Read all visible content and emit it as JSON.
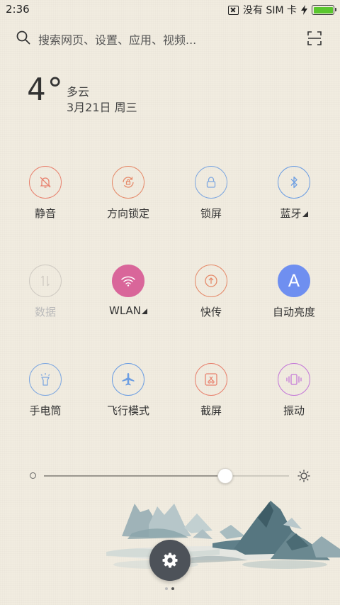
{
  "status_bar": {
    "time": "2:36",
    "carrier": "没有 SIM 卡",
    "icons": [
      "no-sim-icon",
      "charging-bolt-icon",
      "battery-icon"
    ],
    "battery_level_pct": 100,
    "battery_color": "#5ac62e"
  },
  "search": {
    "placeholder": "搜索网页、设置、应用、视频...",
    "icons": [
      "search-icon",
      "scan-icon"
    ]
  },
  "weather": {
    "temperature": "4°",
    "condition": "多云",
    "date": "3月21日 周三"
  },
  "toggles": [
    {
      "label": "静音",
      "icon": "bell-off-icon",
      "color": "#e8826f",
      "active": false,
      "has_arrow": false
    },
    {
      "label": "方向锁定",
      "icon": "rotation-lock-icon",
      "color": "#e58a6a",
      "active": false,
      "has_arrow": false
    },
    {
      "label": "锁屏",
      "icon": "lock-icon",
      "color": "#7fa8e0",
      "active": false,
      "has_arrow": false
    },
    {
      "label": "蓝牙",
      "icon": "bluetooth-icon",
      "color": "#6d9ee2",
      "active": false,
      "has_arrow": true
    },
    {
      "label": "数据",
      "icon": "mobile-data-icon",
      "color": "#cfcac2",
      "active": false,
      "has_arrow": false,
      "disabled": true
    },
    {
      "label": "WLAN",
      "icon": "wifi-icon",
      "color": "#d9669a",
      "active": true,
      "has_arrow": true
    },
    {
      "label": "快传",
      "icon": "quick-transfer-icon",
      "color": "#e58a6a",
      "active": false,
      "has_arrow": false
    },
    {
      "label": "自动亮度",
      "icon": "auto-brightness-icon",
      "color": "#6f8ff0",
      "active": true,
      "has_arrow": false
    },
    {
      "label": "手电筒",
      "icon": "flashlight-icon",
      "color": "#7fa8e0",
      "active": false,
      "has_arrow": false
    },
    {
      "label": "飞行模式",
      "icon": "airplane-icon",
      "color": "#6d9ee2",
      "active": false,
      "has_arrow": false
    },
    {
      "label": "截屏",
      "icon": "screenshot-icon",
      "color": "#e8826f",
      "active": false,
      "has_arrow": false
    },
    {
      "label": "振动",
      "icon": "vibrate-icon",
      "color": "#c57ad8",
      "active": false,
      "has_arrow": false
    }
  ],
  "auto_brightness_letter": "A",
  "brightness": {
    "level_fraction": 0.74,
    "icons": [
      "brightness-low-icon",
      "brightness-high-icon"
    ]
  },
  "settings_button": {
    "icon": "gear-icon"
  },
  "pager": {
    "count": 2,
    "active_index": 1
  }
}
